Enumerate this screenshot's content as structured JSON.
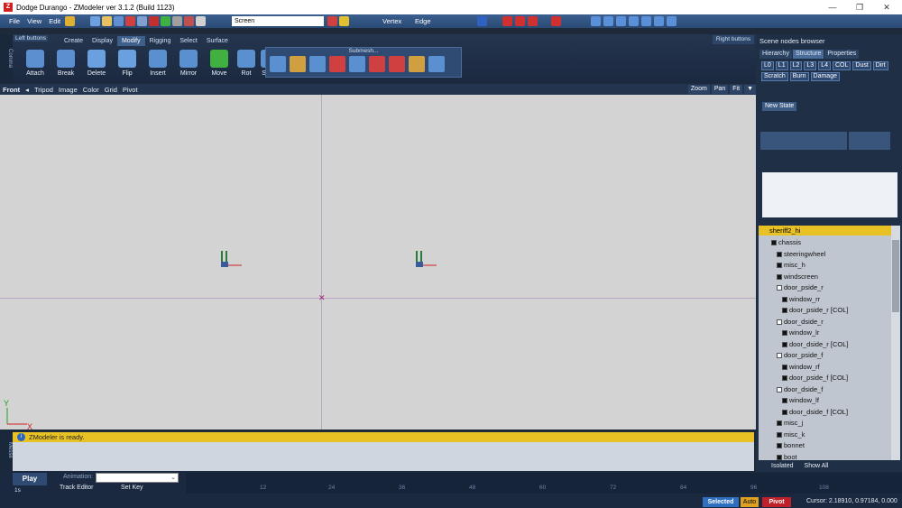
{
  "window": {
    "title": "Dodge Durango - ZModeler ver 3.1.2 (Build 1123)",
    "controls": [
      "—",
      "❐",
      "✕"
    ]
  },
  "menu": {
    "items": [
      "File",
      "View",
      "Edit"
    ],
    "screen_select": "Screen",
    "vertex_label": "Vertex",
    "edge_label": "Edge"
  },
  "cmd": {
    "left_label": "Left buttons",
    "right_label": "Right buttons",
    "side_label": "Comma",
    "tabs": [
      "Create",
      "Display",
      "Modify",
      "Rigging",
      "Select",
      "Surface"
    ],
    "active_tab": "Modify",
    "tools": [
      "Attach",
      "Break",
      "Delete",
      "Flip",
      "Insert",
      "Mirror",
      "Move",
      "Rot",
      "Scale"
    ],
    "submesh_title": "Submesh..."
  },
  "viewport_bar": {
    "items": [
      "Front",
      "Tripod",
      "Image",
      "Color",
      "Grid",
      "Pivot"
    ],
    "zoom": "Zoom",
    "pan": "Pan",
    "fit": "Fit"
  },
  "log": {
    "message": "ZModeler is ready.",
    "side_label": "Messe"
  },
  "timeline": {
    "play": "Play",
    "animation_label": "Animation:",
    "track_editor": "Track Editor",
    "set_key": "Set Key",
    "frame_in": "1s",
    "ticks": [
      "12",
      "24",
      "36",
      "48",
      "60",
      "72",
      "84",
      "96",
      "108"
    ]
  },
  "statusbar": {
    "selected": "Selected",
    "auto": "Auto",
    "pivot": "Pivot",
    "cursor": "Cursor: 2.18910, 0.97184, 0.000"
  },
  "scene_browser": {
    "title": "Scene nodes browser",
    "tabs": [
      "Hierarchy",
      "Structure",
      "Properties"
    ],
    "active_tab": "Structure",
    "toggles": [
      "L0",
      "L1",
      "L2",
      "L3",
      "L4",
      "COL",
      "Dust",
      "Dirt",
      "Scratch",
      "Burn",
      "Damage"
    ],
    "new_state": "New State",
    "show_all": "Show All",
    "isolated": "Isolated",
    "root": "sheriff2_hi",
    "nodes": [
      {
        "label": "chassis",
        "depth": 1,
        "check": false
      },
      {
        "label": "steeringwheel",
        "depth": 2,
        "check": false
      },
      {
        "label": "misc_h",
        "depth": 2,
        "check": false
      },
      {
        "label": "windscreen",
        "depth": 2,
        "check": false
      },
      {
        "label": "door_pside_r",
        "depth": 2,
        "check": true
      },
      {
        "label": "window_rr",
        "depth": 3,
        "check": false
      },
      {
        "label": "door_pside_r [COL]",
        "depth": 3,
        "check": false
      },
      {
        "label": "door_dside_r",
        "depth": 2,
        "check": true
      },
      {
        "label": "window_lr",
        "depth": 3,
        "check": false
      },
      {
        "label": "door_dside_r [COL]",
        "depth": 3,
        "check": false
      },
      {
        "label": "door_pside_f",
        "depth": 2,
        "check": true
      },
      {
        "label": "window_rf",
        "depth": 3,
        "check": false
      },
      {
        "label": "door_pside_f [COL]",
        "depth": 3,
        "check": false
      },
      {
        "label": "door_dside_f",
        "depth": 2,
        "check": true
      },
      {
        "label": "window_lf",
        "depth": 3,
        "check": false
      },
      {
        "label": "door_dside_f [COL]",
        "depth": 3,
        "check": false
      },
      {
        "label": "misc_j",
        "depth": 2,
        "check": false
      },
      {
        "label": "misc_k",
        "depth": 2,
        "check": false
      },
      {
        "label": "bonnet",
        "depth": 2,
        "check": false
      },
      {
        "label": "boot",
        "depth": 2,
        "check": false
      }
    ]
  },
  "colors": {
    "accent": "#e8c225",
    "viewport": "#d3d3d3",
    "panel": "#1f2f46"
  }
}
